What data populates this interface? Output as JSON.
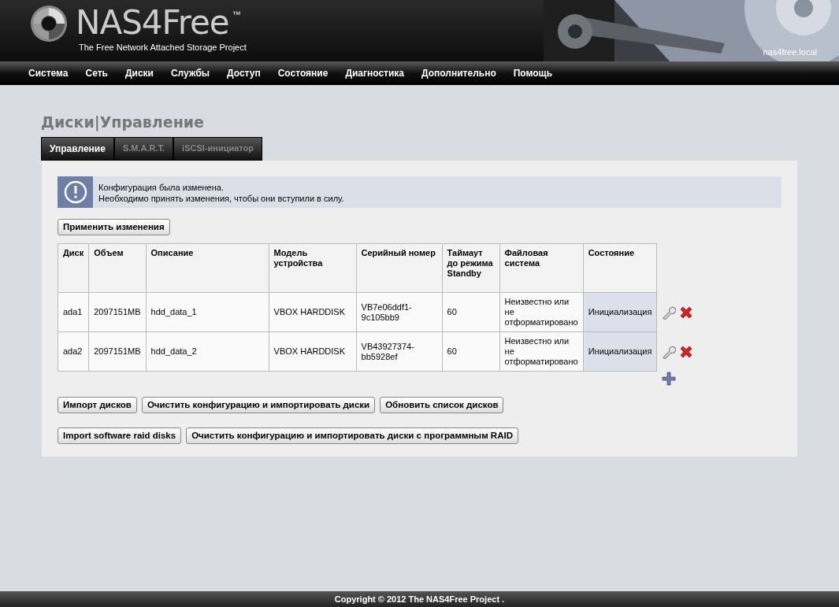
{
  "header": {
    "logo_text": "NAS4Free",
    "trademark": "™",
    "tagline": "The Free Network Attached Storage Project",
    "hostname": "nas4free.local"
  },
  "nav": [
    "Система",
    "Сеть",
    "Диски",
    "Службы",
    "Доступ",
    "Состояние",
    "Диагностика",
    "Дополнительно",
    "Помощь"
  ],
  "page_title": "Диски|Управление",
  "tabs": [
    {
      "label": "Управление",
      "selected": true
    },
    {
      "label": "S.M.A.R.T.",
      "selected": false
    },
    {
      "label": "iSCSI-инициатор",
      "selected": false
    }
  ],
  "notice": {
    "lines": [
      "Конфигурация была изменена.",
      "Необходимо принять изменения, чтобы они вступили в силу."
    ]
  },
  "apply_button": "Применить изменения",
  "table": {
    "columns": [
      "Диск",
      "Объем",
      "Описание",
      "Модель устройства",
      "Серийный номер",
      "Таймаут до режима Standby",
      "Файловая система",
      "Состояние"
    ],
    "rows": [
      {
        "cells": [
          "ada1",
          "2097151MB",
          "hdd_data_1",
          "VBOX HARDDISK",
          "VB7e06ddf1-9c105bb9",
          "60",
          "Неизвестно или не отформатировано",
          "Инициализация"
        ]
      },
      {
        "cells": [
          "ada2",
          "2097151MB",
          "hdd_data_2",
          "VBOX HARDDISK",
          "VB43927374-bb5928ef",
          "60",
          "Неизвестно или не отформатировано",
          "Инициализация"
        ]
      }
    ]
  },
  "button_rows": [
    [
      "Импорт дисков",
      "Очистить конфигурацию и импортировать диски",
      "Обновить список дисков"
    ],
    [
      "Import software raid disks",
      "Очистить конфигурацию и импортировать диски с программным RAID"
    ]
  ],
  "footer": "Copyright © 2012 The NAS4Free Project ."
}
